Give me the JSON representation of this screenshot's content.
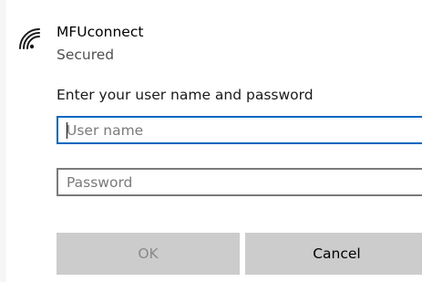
{
  "network": {
    "name": "MFUconnect",
    "status": "Secured",
    "icon": "wifi-secured-icon"
  },
  "form": {
    "prompt": "Enter your user name and password",
    "username": {
      "value": "",
      "placeholder": "User name"
    },
    "password": {
      "value": "",
      "placeholder": "Password"
    }
  },
  "buttons": {
    "ok_label": "OK",
    "ok_enabled": false,
    "cancel_label": "Cancel"
  },
  "colors": {
    "focus_border": "#0067c0",
    "button_bg": "#cccccc",
    "disabled_text": "#8a8a8a"
  }
}
